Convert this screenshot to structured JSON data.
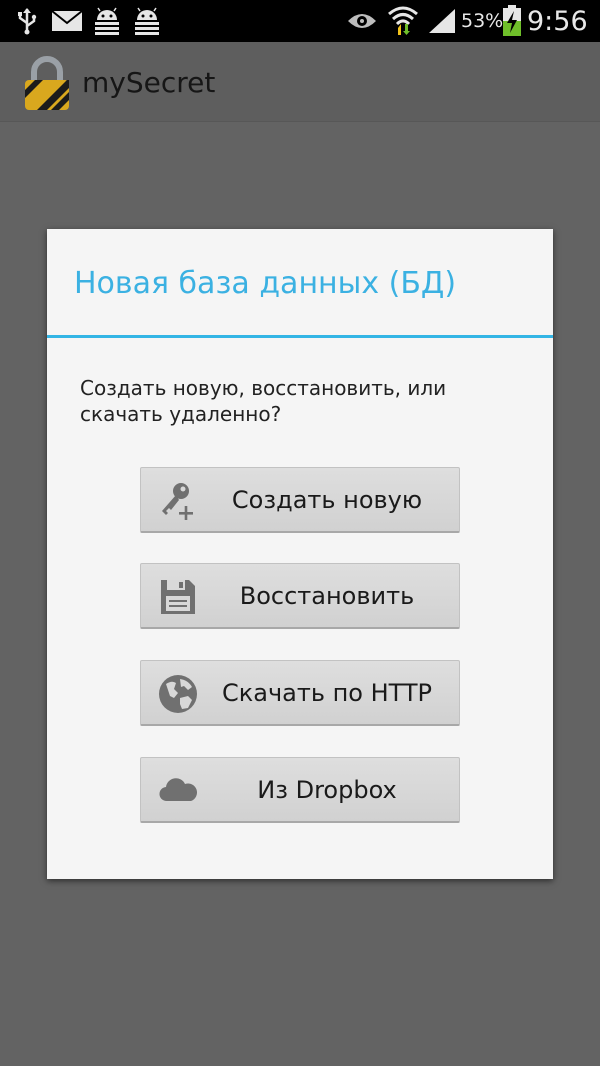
{
  "status_bar": {
    "battery_percent": "53%",
    "time": "9:56",
    "icons": [
      "usb-icon",
      "mail-icon",
      "android-debug-icon",
      "android-debug-icon",
      "eye-icon",
      "wifi-icon",
      "signal-icon",
      "battery-charging-icon"
    ]
  },
  "action_bar": {
    "title": "mySecret",
    "icon": "padlock-icon"
  },
  "dialog": {
    "title": "Новая база данных (БД)",
    "message": "Создать новую, восстановить, или скачать удаленно?",
    "buttons": [
      {
        "label": "Создать новую",
        "icon": "key-plus-icon"
      },
      {
        "label": "Восстановить",
        "icon": "floppy-disk-icon"
      },
      {
        "label": "Скачать по HTTP",
        "icon": "globe-icon"
      },
      {
        "label": "Из Dropbox",
        "icon": "cloud-icon"
      }
    ]
  },
  "colors": {
    "accent": "#33b5e5",
    "background": "#636363",
    "dialog_bg": "#f5f5f5",
    "button_bg": "#d6d6d6"
  }
}
